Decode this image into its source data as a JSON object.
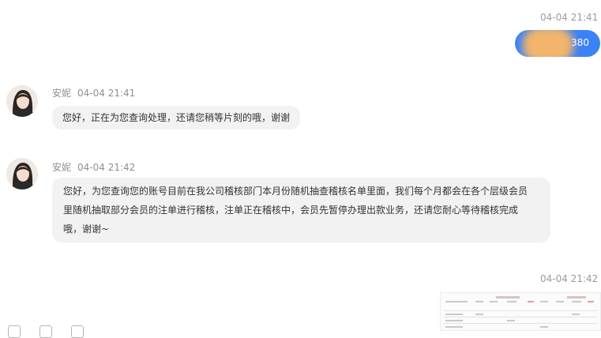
{
  "messages": {
    "outgoing": {
      "time": "04-04 21:41",
      "text_suffix": "380"
    },
    "incoming": [
      {
        "sender": "安妮",
        "time": "04-04 21:41",
        "text": "您好，正在为您查询处理，还请您稍等片刻的哦，谢谢"
      },
      {
        "sender": "安妮",
        "time": "04-04 21:42",
        "lines": [
          "您好，为您查询您的账号目前在我公司稽核部门本月份随机抽查稽核名单里面，我们每个月都会在各个层级会员",
          "里随机抽取部分会员的注单进行稽核，注单正在稽核中，会员先暂停办理出款业务，还请您耐心等待稽核完成",
          "哦，谢谢~"
        ]
      }
    ],
    "outgoing_image": {
      "time": "04-04 21:42"
    }
  },
  "colors": {
    "outgoing_bubble": "#3b82f6",
    "incoming_bubble": "#f2f2f2",
    "timestamp": "#9a9a9a",
    "redaction": "#f2b56b"
  },
  "icons": [
    "avatar",
    "table-thumbnail-image",
    "toolbar-icon"
  ]
}
